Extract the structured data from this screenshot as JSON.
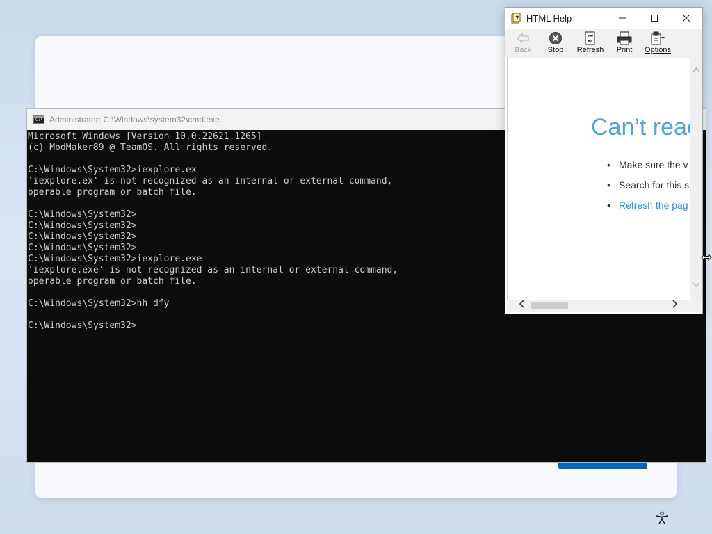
{
  "cmd": {
    "title": "Administrator: C:\\Windows\\system32\\cmd.exe",
    "icon_text": "C:\\_",
    "lines": [
      "Microsoft Windows [Version 10.0.22621.1265]",
      "(c) ModMaker89 @ TeamOS. All rights reserved.",
      "",
      "C:\\Windows\\System32>iexplore.ex",
      "'iexplore.ex' is not recognized as an internal or external command,",
      "operable program or batch file.",
      "",
      "C:\\Windows\\System32>",
      "C:\\Windows\\System32>",
      "C:\\Windows\\System32>",
      "C:\\Windows\\System32>",
      "C:\\Windows\\System32>iexplore.exe",
      "'iexplore.exe' is not recognized as an internal or external command,",
      "operable program or batch file.",
      "",
      "C:\\Windows\\System32>hh dfy",
      "",
      "C:\\Windows\\System32>"
    ]
  },
  "help": {
    "title": "HTML Help",
    "toolbar": {
      "back": "Back",
      "stop": "Stop",
      "refresh": "Refresh",
      "print": "Print",
      "options": "Options"
    },
    "error_title": "Can’t reac",
    "items": [
      "Make sure the v",
      "Search for this s",
      "Refresh the pag"
    ],
    "link_color": "#2b8fd1",
    "title_color": "#4fa3d8"
  },
  "colors": {
    "cmd_background": "#0c0c0c",
    "cmd_text": "#cccccc",
    "oobe_accent": "#0067c0"
  },
  "icons": {
    "accessibility": "accessibility-icon",
    "minimize": "minimize-icon",
    "maximize": "maximize-icon",
    "close": "close-icon"
  }
}
